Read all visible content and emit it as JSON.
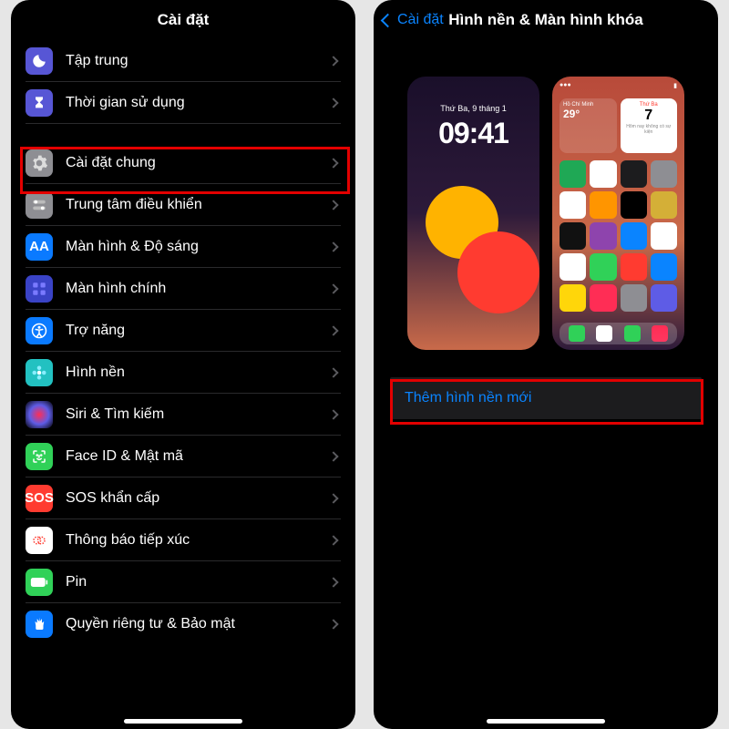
{
  "left": {
    "title": "Cài đặt",
    "rows_group1": [
      {
        "key": "focus",
        "label": "Tập trung"
      },
      {
        "key": "screen",
        "label": "Thời gian sử dụng"
      }
    ],
    "rows_group2": [
      {
        "key": "general",
        "label": "Cài đặt chung",
        "highlight": true
      },
      {
        "key": "control",
        "label": "Trung tâm điều khiển"
      },
      {
        "key": "display",
        "label": "Màn hình & Độ sáng"
      },
      {
        "key": "home",
        "label": "Màn hình chính"
      },
      {
        "key": "access",
        "label": "Trợ năng"
      },
      {
        "key": "wall",
        "label": "Hình nền"
      },
      {
        "key": "siri",
        "label": "Siri & Tìm kiếm"
      },
      {
        "key": "face",
        "label": "Face ID & Mật mã"
      },
      {
        "key": "sos",
        "label": "SOS khẩn cấp"
      },
      {
        "key": "expose",
        "label": "Thông báo tiếp xúc"
      },
      {
        "key": "battery",
        "label": "Pin"
      },
      {
        "key": "privacy",
        "label": "Quyền riêng tư & Bảo mật"
      }
    ],
    "sos_text": "SOS",
    "aa_text": "AA"
  },
  "right": {
    "back": "Cài đặt",
    "title": "Hình nền & Màn hình khóa",
    "lock": {
      "date": "Thứ Ba, 9 tháng 1",
      "time": "09:41"
    },
    "home": {
      "carrier": "",
      "weather_city": "Hồ Chí Minh",
      "weather_temp": "29°",
      "cal_day": "Thứ Ba",
      "cal_num": "7",
      "cal_sub": "Hôm nay không có sự kiện"
    },
    "add_label": "Thêm hình nền mới"
  }
}
